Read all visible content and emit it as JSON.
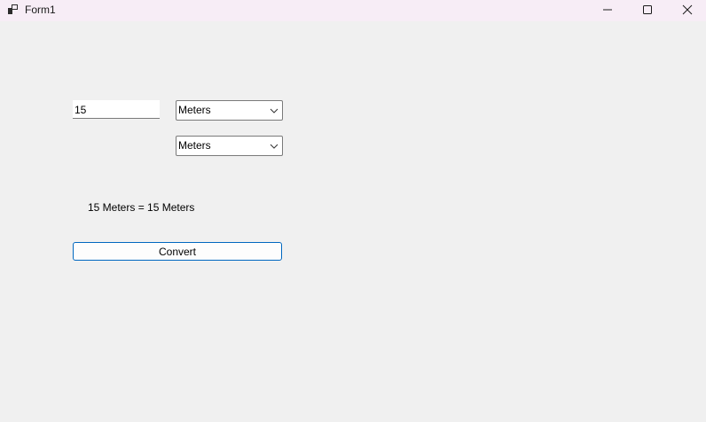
{
  "window": {
    "title": "Form1",
    "icons": {
      "app": "app-icon",
      "minimize": "minimize-icon",
      "maximize": "maximize-icon",
      "close": "close-icon"
    }
  },
  "form": {
    "input_value": "15",
    "from_unit": "Meters",
    "to_unit": "Meters",
    "result_text": "15 Meters = 15 Meters",
    "convert_label": "Convert"
  },
  "colors": {
    "titlebar": "#f7edf6",
    "background": "#f0f0f0",
    "button_border": "#0067c0"
  }
}
